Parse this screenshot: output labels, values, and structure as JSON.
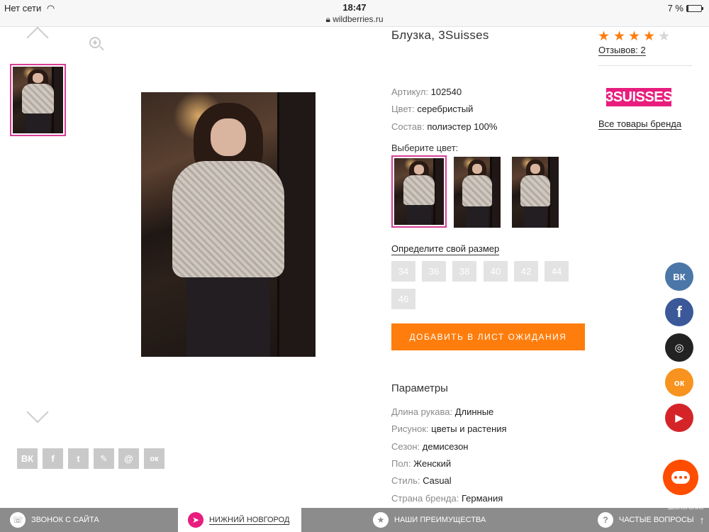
{
  "statusbar": {
    "carrier": "Нет сети",
    "time": "18:47",
    "url": "wildberries.ru",
    "battery": "7 %"
  },
  "product": {
    "title": "Блузка, 3Suisses",
    "article_label": "Артикул:",
    "article": "102540",
    "color_label": "Цвет:",
    "color": "серебристый",
    "composition_label": "Состав:",
    "composition": "полиэстер 100%",
    "choose_color": "Выберите цвет:",
    "size_link": "Определите свой размер",
    "sizes": [
      "34",
      "36",
      "38",
      "40",
      "42",
      "44",
      "46"
    ],
    "wait_button": "ДОБАВИТЬ В ЛИСТ ОЖИДАНИЯ",
    "params_title": "Параметры",
    "params": [
      {
        "label": "Длина рукава:",
        "value": "Длинные"
      },
      {
        "label": "Рисунок:",
        "value": "цветы и растения"
      },
      {
        "label": "Сезон:",
        "value": "демисезон"
      },
      {
        "label": "Пол:",
        "value": "Женский"
      },
      {
        "label": "Стиль:",
        "value": "Casual"
      },
      {
        "label": "Страна бренда:",
        "value": "Германия"
      }
    ]
  },
  "rating": {
    "stars": 4,
    "max": 5,
    "reviews": "Отзывов: 2"
  },
  "brand": {
    "logo_text": "3SUISSES",
    "all_products": "Все товары бренда"
  },
  "share_icons": [
    "ВК",
    "f",
    "t",
    "✎",
    "@",
    "ок"
  ],
  "social": {
    "vk": "ВК",
    "fb": "f",
    "ig": "◎",
    "ok": "ок",
    "yt": "▶"
  },
  "bottombar": {
    "call": "ЗВОНОК С САЙТА",
    "city": "НИЖНИЙ НОВГОРОД",
    "advantages": "НАШИ ПРЕИМУЩЕСТВА",
    "faq": "ЧАСТЫЕ ВОПРОСЫ"
  },
  "watermark": "Шопоголик",
  "colors": {
    "accent": "#ff7d0c",
    "brand_pink": "#d63f95",
    "star": "#ff7d0c",
    "vk": "#4a76a8",
    "fb": "#3b5998",
    "ig": "#222222",
    "ok": "#f7931e",
    "yt": "#d42428"
  }
}
